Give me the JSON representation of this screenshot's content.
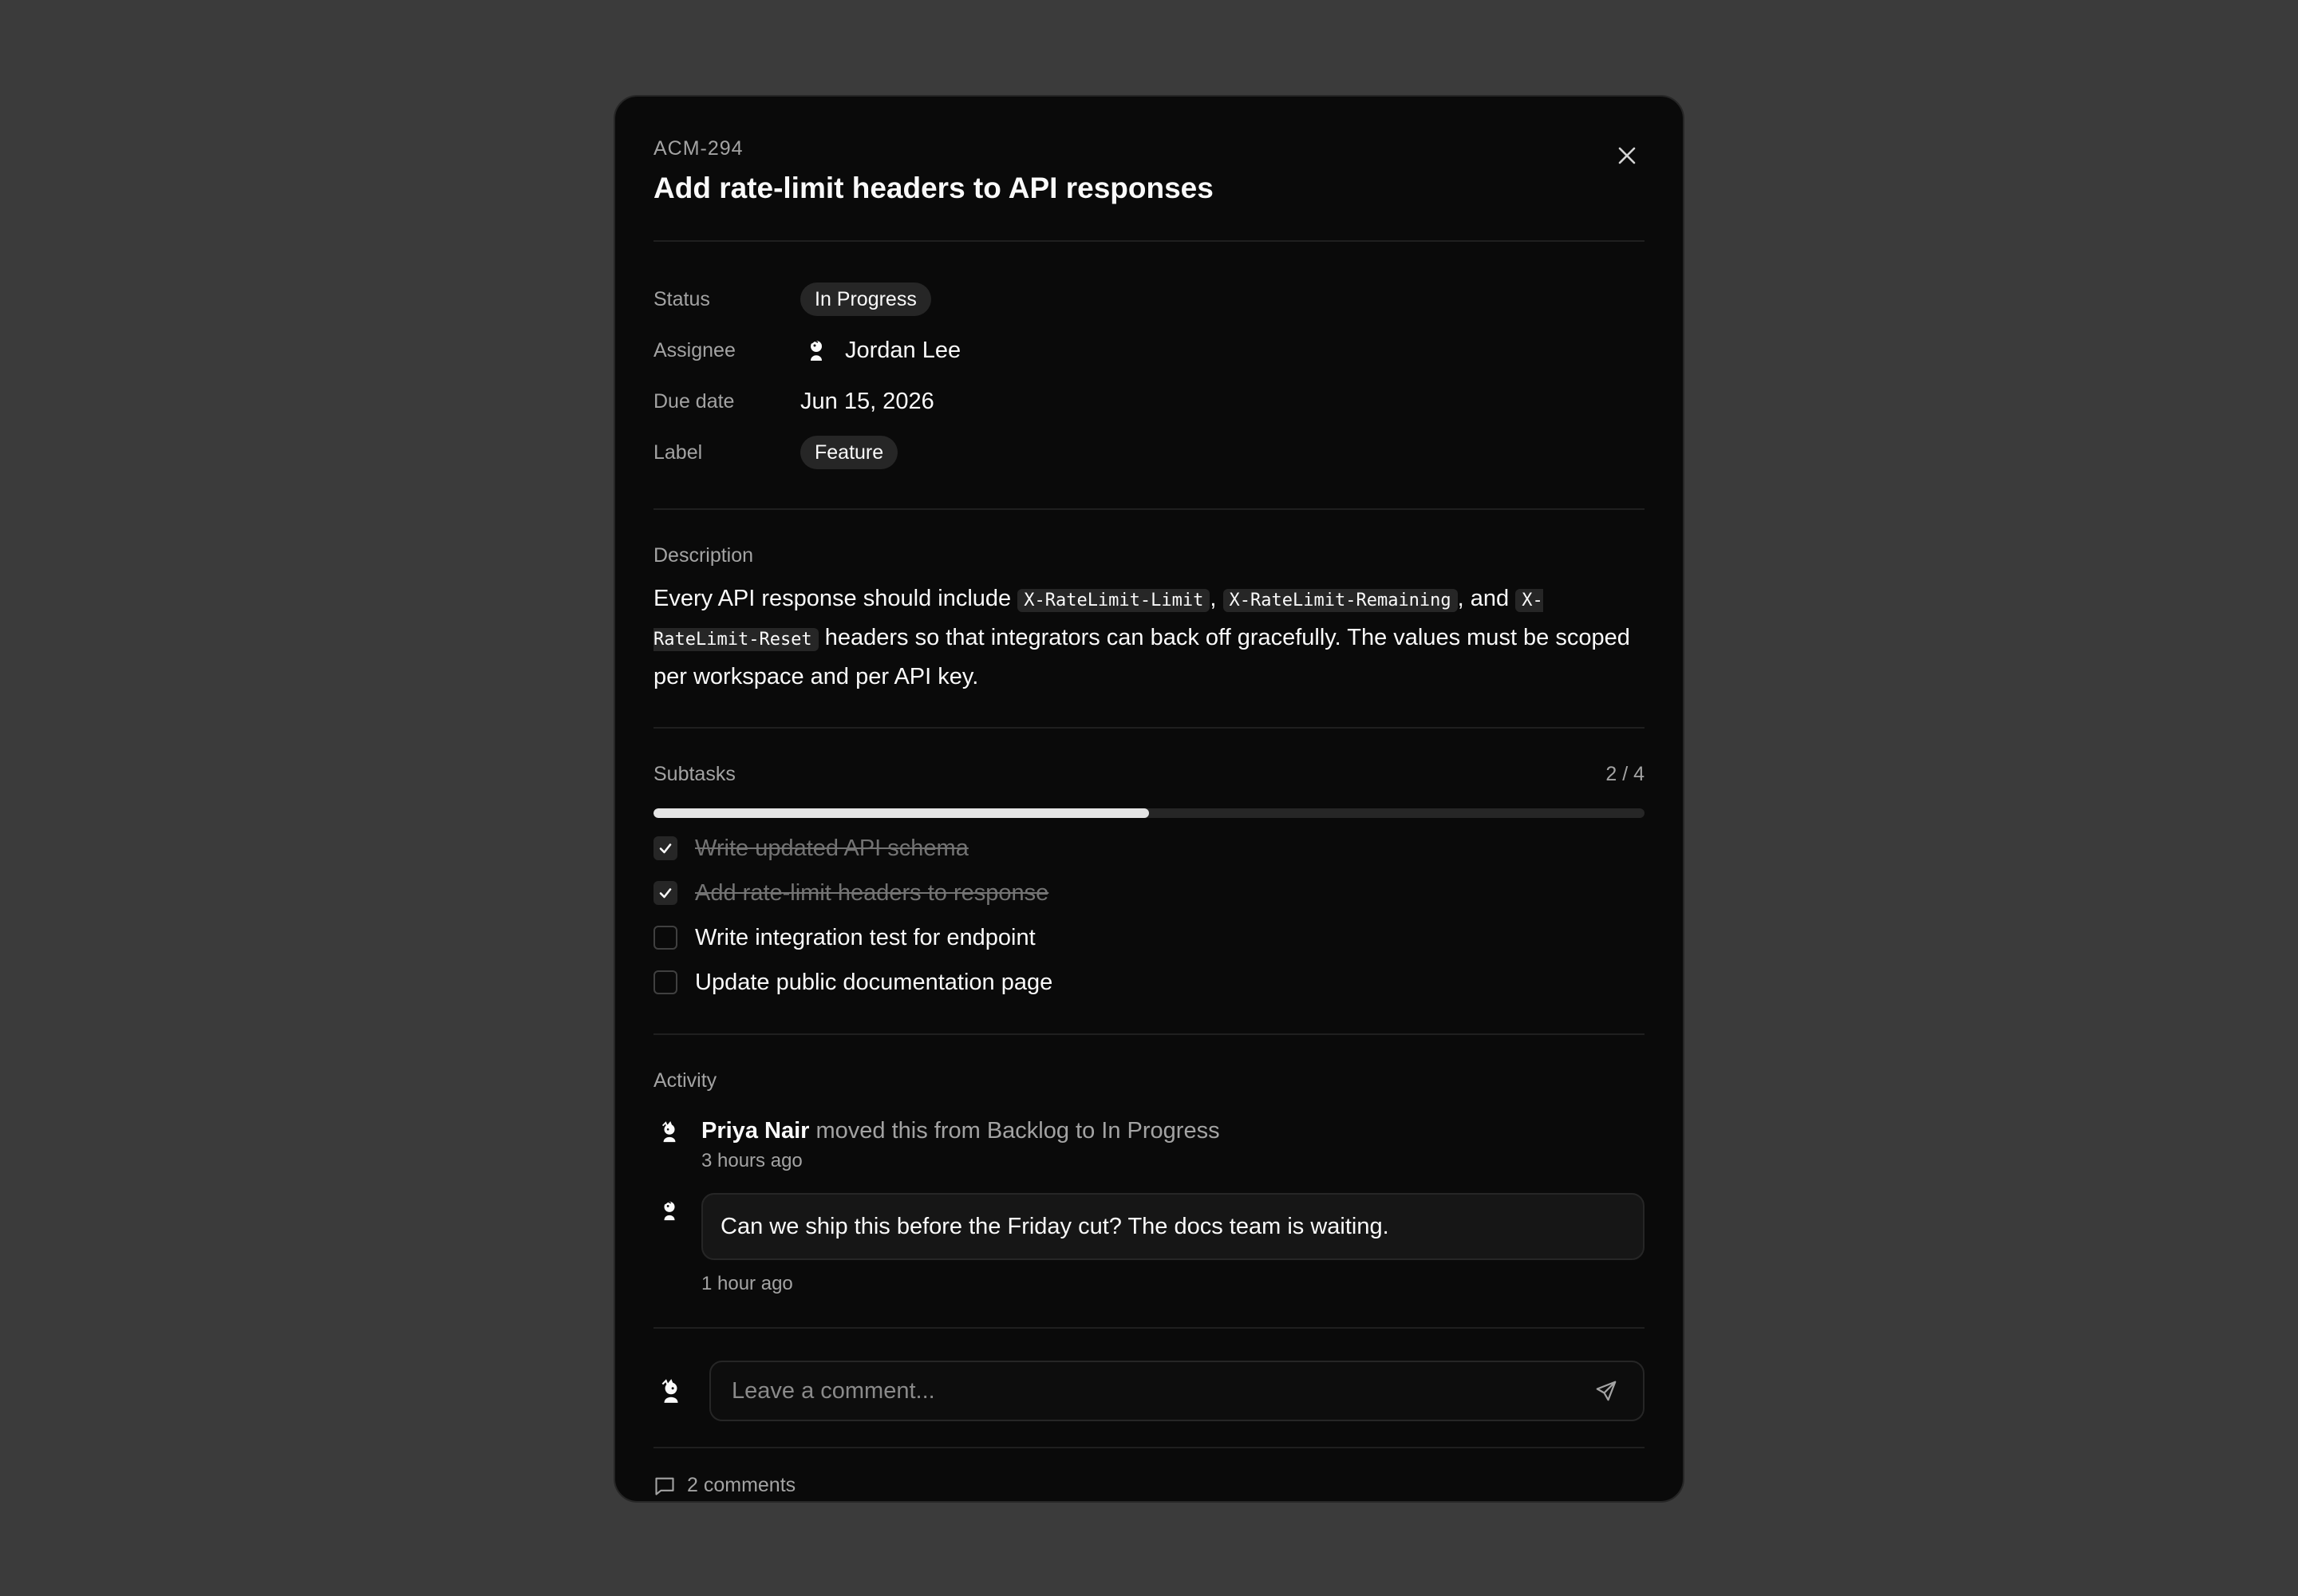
{
  "issue": {
    "key": "ACM-294",
    "title": "Add rate-limit headers to API responses"
  },
  "properties": {
    "status": {
      "label": "Status",
      "value": "In Progress"
    },
    "assignee": {
      "label": "Assignee",
      "value": "Jordan Lee"
    },
    "due_date": {
      "label": "Due date",
      "value": "Jun 15, 2026"
    },
    "label": {
      "label": "Label",
      "value": "Feature"
    }
  },
  "description": {
    "heading": "Description",
    "text_1": "Every API response should include ",
    "code_1": "X-RateLimit-Limit",
    "text_2": ", ",
    "code_2": "X-RateLimit-Remaining",
    "text_3": ", and ",
    "code_3": "X-RateLimit-Reset",
    "text_4": " headers so that integrators can back off gracefully. The values must be scoped per workspace and per API key."
  },
  "subtasks": {
    "heading": "Subtasks",
    "count": "2 / 4",
    "progress": 0.5,
    "items": [
      {
        "label": "Write updated API schema",
        "done": true
      },
      {
        "label": "Add rate-limit headers to response",
        "done": true
      },
      {
        "label": "Write integration test for endpoint",
        "done": false
      },
      {
        "label": "Update public documentation page",
        "done": false
      }
    ]
  },
  "activity": {
    "heading": "Activity",
    "event": {
      "actor": "Priya Nair",
      "action": " moved this from Backlog to In Progress",
      "time": "3 hours ago"
    },
    "comment": {
      "text": "Can we ship this before the Friday cut? The docs team is waiting.",
      "time": "1 hour ago"
    }
  },
  "composer": {
    "placeholder": "Leave a comment..."
  },
  "footer": {
    "comments": "2 comments"
  },
  "colors": {
    "backdrop": "#3b3b3b",
    "panel": "#0a0a0a",
    "badge": "#262626",
    "progress_fill": "#e5e5e5"
  },
  "icons": {
    "close": "close-icon",
    "send": "send-icon",
    "comments": "comment-icon",
    "check": "check-icon"
  }
}
